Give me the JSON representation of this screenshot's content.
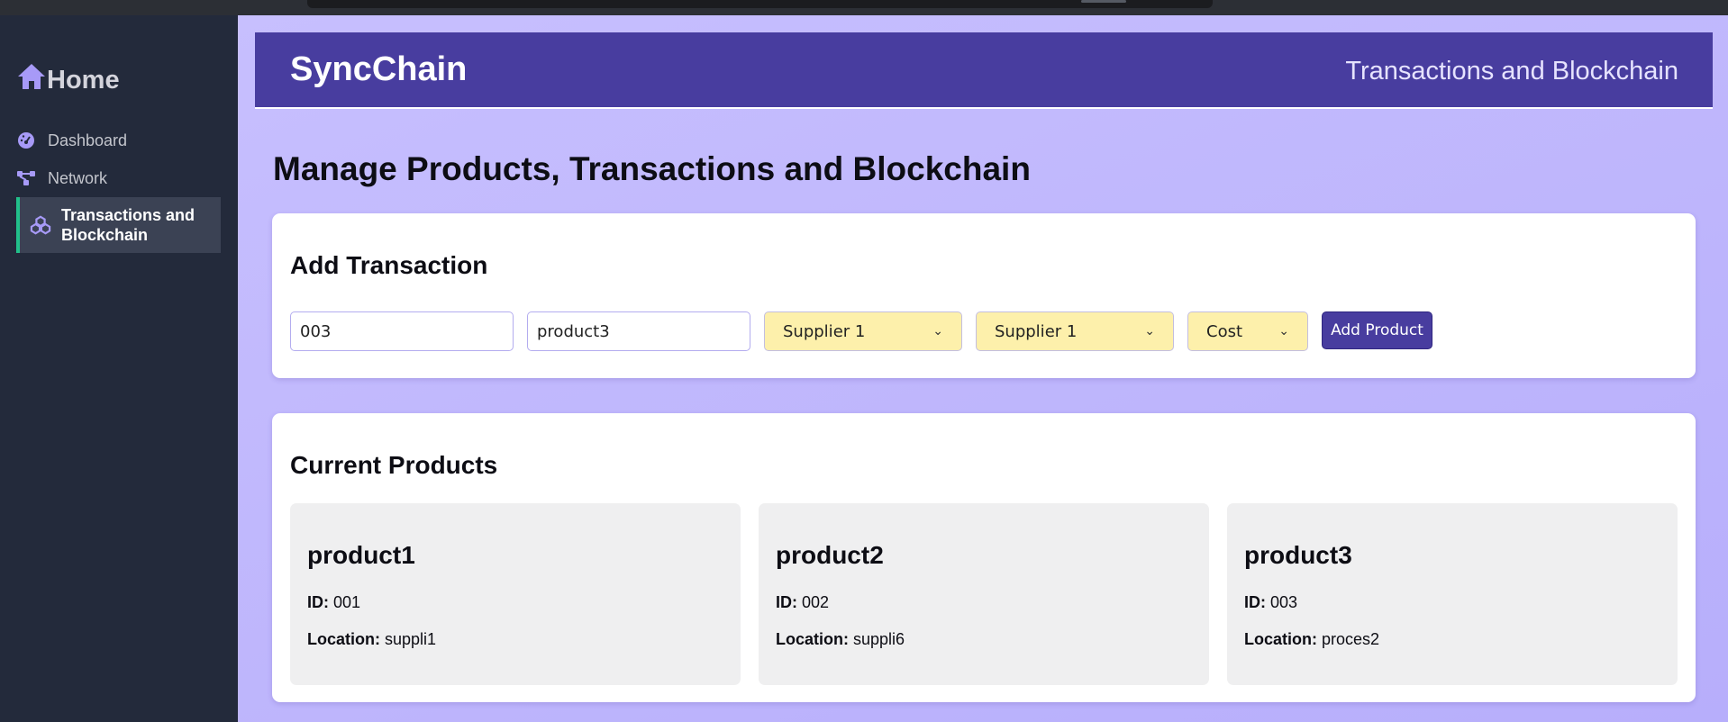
{
  "sidebar": {
    "home_label": "Home",
    "items": [
      {
        "label": "Dashboard",
        "icon": "dashboard-icon"
      },
      {
        "label": "Network",
        "icon": "network-icon"
      },
      {
        "label": "Transactions and Blockchain",
        "icon": "cubes-icon",
        "active": true
      }
    ]
  },
  "header": {
    "brand": "SyncChain",
    "subtitle": "Transactions and Blockchain"
  },
  "page": {
    "title": "Manage Products, Transactions and Blockchain"
  },
  "add_transaction": {
    "title": "Add Transaction",
    "id_value": "003",
    "name_value": "product3",
    "from_select": "Supplier 1",
    "to_select": "Supplier 1",
    "type_select": "Cost",
    "button_label": "Add Product"
  },
  "products": {
    "title": "Current Products",
    "id_label": "ID:",
    "location_label": "Location:",
    "items": [
      {
        "name": "product1",
        "id": "001",
        "location": "suppli1"
      },
      {
        "name": "product2",
        "id": "002",
        "location": "suppli6"
      },
      {
        "name": "product3",
        "id": "003",
        "location": "proces2"
      }
    ]
  },
  "colors": {
    "sidebar_bg": "#232a3b",
    "header_bg": "#483d9f",
    "main_bg": "#c7bffe",
    "select_bg": "#fdf0ab",
    "active_accent": "#21c08a"
  }
}
